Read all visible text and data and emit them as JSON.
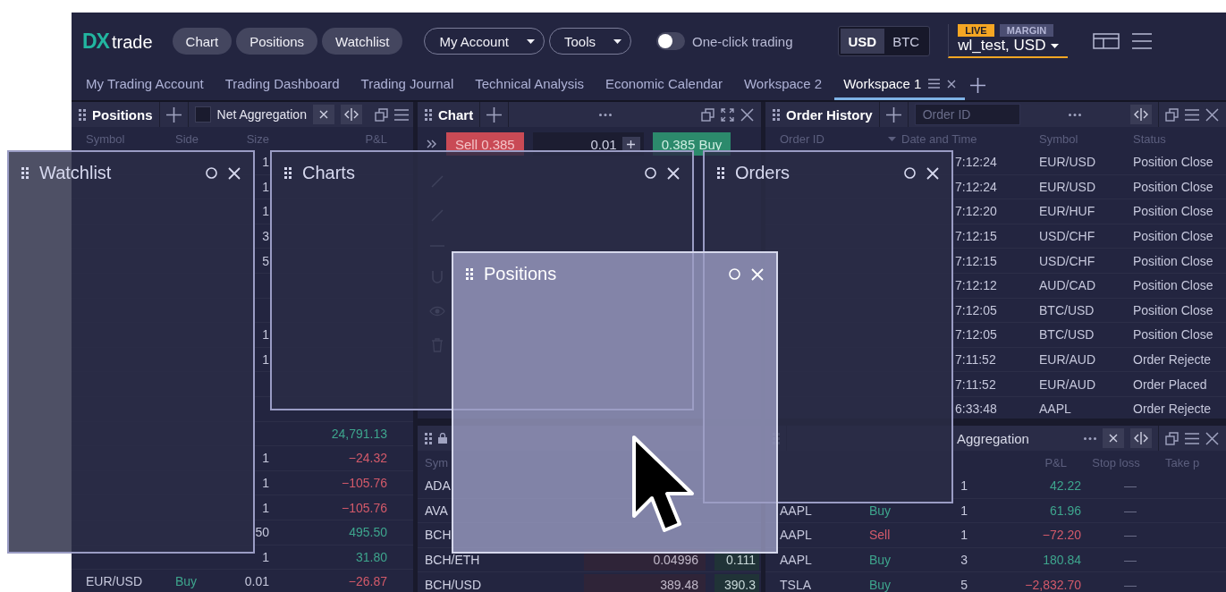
{
  "logo": {
    "mark": "DX",
    "word": "trade"
  },
  "nav_buttons": [
    "Chart",
    "Positions",
    "Watchlist"
  ],
  "dropdowns": [
    "My Account",
    "Tools"
  ],
  "one_click_trading": {
    "label": "One-click trading",
    "on": false
  },
  "currency": [
    {
      "label": "USD",
      "selected": true
    },
    {
      "label": "BTC",
      "selected": false
    }
  ],
  "account": {
    "badges": [
      {
        "label": "LIVE",
        "kind": "live"
      },
      {
        "label": "MARGIN",
        "kind": "type"
      }
    ],
    "name": "wl_test, USD"
  },
  "workspace_tabs": [
    {
      "label": "My Trading Account",
      "selected": false
    },
    {
      "label": "Trading Dashboard",
      "selected": false
    },
    {
      "label": "Trading Journal",
      "selected": false
    },
    {
      "label": "Technical Analysis",
      "selected": false
    },
    {
      "label": "Economic Calendar",
      "selected": false
    },
    {
      "label": "Workspace 2",
      "selected": false
    },
    {
      "label": "Workspace 1",
      "selected": true
    }
  ],
  "positions_panel": {
    "title": "Positions",
    "filter_label": "Net Aggregation",
    "filter_checked": false,
    "columns": [
      "Symbol",
      "Side",
      "Size",
      "P&L"
    ],
    "rows": [
      {
        "size": "1"
      },
      {
        "size": "1"
      },
      {
        "size": "1"
      },
      {
        "size": "3"
      },
      {
        "size": "5"
      },
      {},
      {},
      {
        "size": "1"
      },
      {
        "size": "1"
      },
      {},
      {},
      {
        "pnl": "24,791.13",
        "color": "#3ea58d"
      },
      {
        "size": "1",
        "pnl": "−24.32",
        "color": "#d45a6a"
      },
      {
        "size": "1",
        "pnl": "−105.76",
        "color": "#d45a6a"
      },
      {
        "size": "1",
        "pnl": "−105.76",
        "color": "#d45a6a"
      },
      {
        "size": "50",
        "pnl": "495.50",
        "color": "#3ea58d"
      },
      {
        "size": "1",
        "pnl": "31.80",
        "color": "#3ea58d"
      },
      {
        "symbol": "EUR/USD",
        "side": "Buy",
        "kind": "buy",
        "size": "0.01",
        "pnl": "−26.87",
        "color": "#d45a6a"
      }
    ]
  },
  "chart_panel": {
    "title": "Chart",
    "sell": "Sell 0.385",
    "quantity": "0.01",
    "buy": "0.385 Buy"
  },
  "crypto_panel": {
    "column": "Sym",
    "rows": [
      {
        "symbol": "ADA"
      },
      {
        "symbol": "AVA"
      },
      {
        "symbol": "BCH"
      },
      {
        "symbol": "BCH/ETH",
        "bid": "0.04996",
        "ask": "0.111"
      },
      {
        "symbol": "BCH/USD",
        "bid": "389.48",
        "ask": "390.3"
      }
    ]
  },
  "order_history_panel": {
    "title": "Order History",
    "search_placeholder": "Order ID",
    "columns": [
      "Order ID",
      "Date and Time",
      "Symbol",
      "Status"
    ],
    "rows": [
      {
        "time": "7:12:24",
        "symbol": "EUR/USD",
        "status": "Position Close"
      },
      {
        "time": "7:12:24",
        "symbol": "EUR/USD",
        "status": "Position Close"
      },
      {
        "time": "7:12:20",
        "symbol": "EUR/HUF",
        "status": "Position Close"
      },
      {
        "time": "7:12:15",
        "symbol": "USD/CHF",
        "status": "Position Close"
      },
      {
        "time": "7:12:15",
        "symbol": "USD/CHF",
        "status": "Position Close"
      },
      {
        "time": "7:12:12",
        "symbol": "AUD/CAD",
        "status": "Position Close"
      },
      {
        "time": "7:12:05",
        "symbol": "BTC/USD",
        "status": "Position Close"
      },
      {
        "time": "7:12:05",
        "symbol": "BTC/USD",
        "status": "Position Close"
      },
      {
        "time": "7:11:52",
        "symbol": "EUR/AUD",
        "status": "Order Rejecte"
      },
      {
        "time": "7:11:52",
        "symbol": "EUR/AUD",
        "status": "Order Placed"
      },
      {
        "time": "6:33:48",
        "symbol": "AAPL",
        "status": "Order Rejecte"
      }
    ]
  },
  "positions_panel_2": {
    "filter_label": "Aggregation",
    "columns": [
      "P&L",
      "Stop loss",
      "Take p"
    ],
    "rows": [
      {
        "size": "1",
        "pnl": "42.22",
        "color": "#3ea58d",
        "stop_loss": "—"
      },
      {
        "symbol": "AAPL",
        "side": "Buy",
        "kind": "buy",
        "size": "1",
        "pnl": "61.96",
        "color": "#3ea58d",
        "stop_loss": "—"
      },
      {
        "symbol": "AAPL",
        "side": "Sell",
        "kind": "sell",
        "size": "1",
        "pnl": "−72.20",
        "color": "#d45a6a",
        "stop_loss": "—"
      },
      {
        "symbol": "AAPL",
        "side": "Buy",
        "kind": "buy",
        "size": "3",
        "pnl": "180.84",
        "color": "#3ea58d",
        "stop_loss": "—"
      },
      {
        "symbol": "TSLA",
        "side": "Buy",
        "kind": "buy",
        "size": "5",
        "pnl": "−2,832.70",
        "color": "#d45a6a",
        "stop_loss": "—"
      }
    ]
  },
  "floating_windows": [
    {
      "title": "Watchlist",
      "kind": "dark"
    },
    {
      "title": "Charts",
      "kind": "dark"
    },
    {
      "title": "Orders",
      "kind": "dark"
    },
    {
      "title": "Positions",
      "kind": "light"
    }
  ]
}
